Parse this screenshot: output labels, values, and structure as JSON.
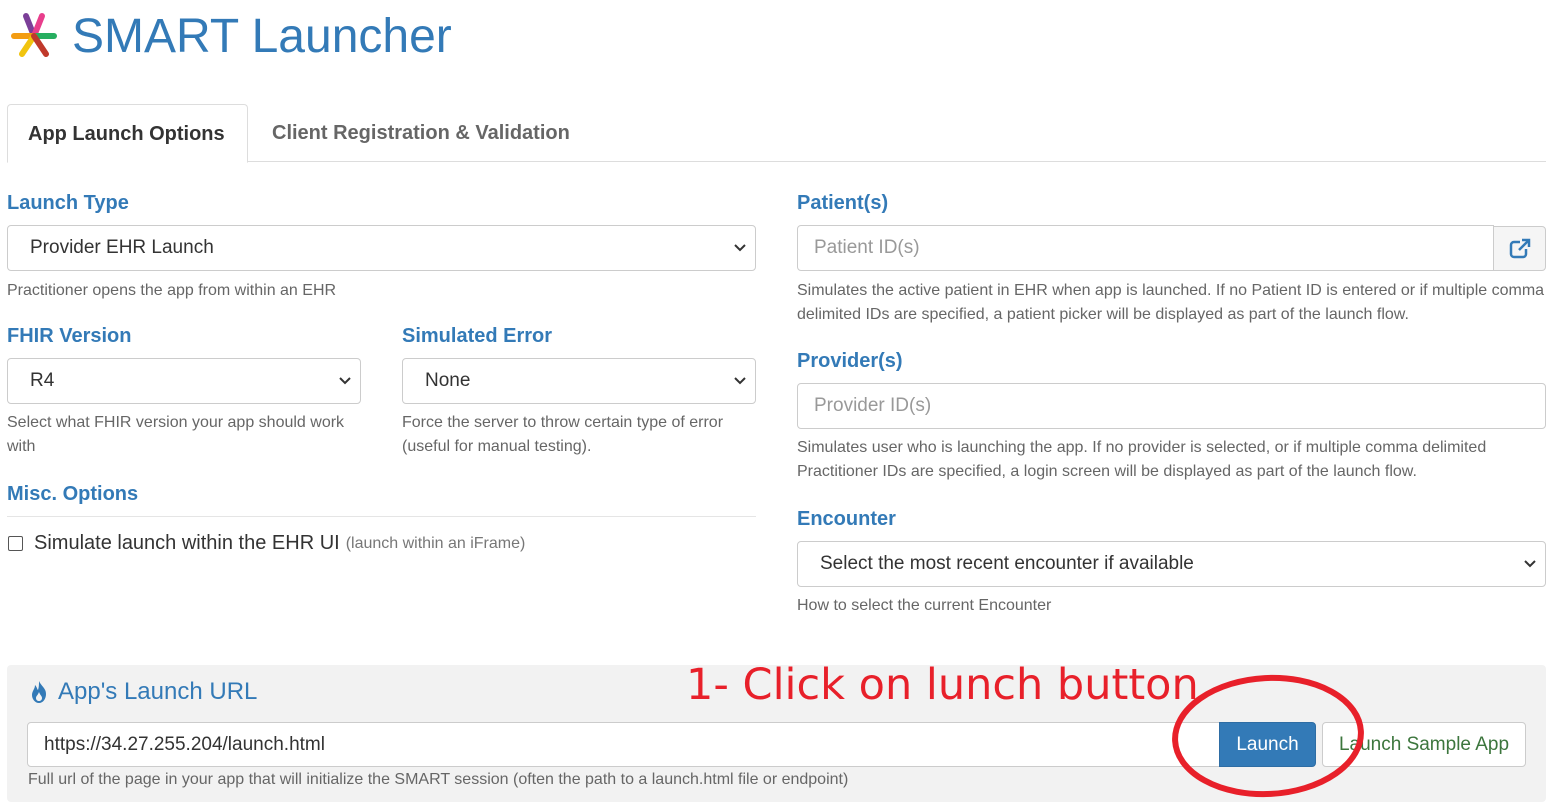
{
  "header": {
    "title": "SMART Launcher",
    "logo_colors": [
      "#7b3f98",
      "#e83e8c",
      "#f39c12",
      "#f1c40f",
      "#27ae60",
      "#c0392b"
    ]
  },
  "tabs": [
    {
      "label": "App Launch Options",
      "active": true
    },
    {
      "label": "Client Registration & Validation",
      "active": false
    }
  ],
  "left": {
    "launch_type": {
      "label": "Launch Type",
      "value": "Provider EHR Launch",
      "help": "Practitioner opens the app from within an EHR"
    },
    "fhir_version": {
      "label": "FHIR Version",
      "value": "R4",
      "help": "Select what FHIR version your app should work with"
    },
    "simulated_error": {
      "label": "Simulated Error",
      "value": "None",
      "help": "Force the server to throw certain type of error (useful for manual testing)."
    },
    "misc": {
      "label": "Misc. Options",
      "checkbox_label": "Simulate launch within the EHR UI",
      "checkbox_sub": "(launch within an iFrame)",
      "checked": false
    }
  },
  "right": {
    "patients": {
      "label": "Patient(s)",
      "placeholder": "Patient ID(s)",
      "help": "Simulates the active patient in EHR when app is launched. If no Patient ID is entered or if multiple comma delimited IDs are specified, a patient picker will be displayed as part of the launch flow."
    },
    "providers": {
      "label": "Provider(s)",
      "placeholder": "Provider ID(s)",
      "help": "Simulates user who is launching the app. If no provider is selected, or if multiple comma delimited Practitioner IDs are specified, a login screen will be displayed as part of the launch flow."
    },
    "encounter": {
      "label": "Encounter",
      "value": "Select the most recent encounter if available",
      "help": "How to select the current Encounter"
    }
  },
  "launch_panel": {
    "title": "App's Launch URL",
    "url": "https://34.27.255.204/launch.html",
    "launch_label": "Launch",
    "sample_label": "Launch Sample App",
    "help": "Full url of the page in your app that will initialize the SMART session (often the path to a launch.html file or endpoint)"
  },
  "annotation": {
    "text": "1- Click on lunch button",
    "color": "#e8202a"
  },
  "colors": {
    "accent": "#337ab7",
    "success_text": "#3c763d"
  }
}
